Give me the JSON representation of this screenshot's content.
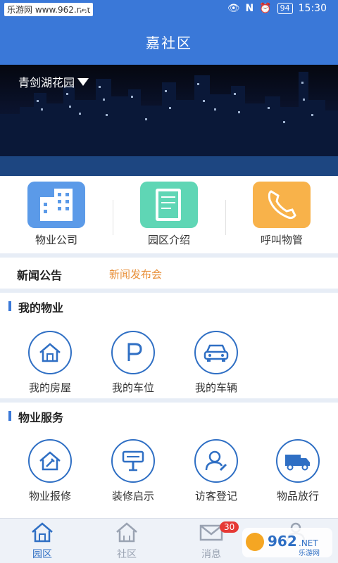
{
  "status_bar": {
    "watermark": "乐游网 www.962.net",
    "battery": "94",
    "time": "15:30"
  },
  "header": {
    "title": "嘉社区"
  },
  "banner": {
    "community": "青剑湖花园"
  },
  "quick_links": [
    {
      "label": "物业公司",
      "icon": "building-icon",
      "color": "#5b9ae8"
    },
    {
      "label": "园区介绍",
      "icon": "document-icon",
      "color": "#5fd6b5"
    },
    {
      "label": "呼叫物管",
      "icon": "phone-icon",
      "color": "#f8b24a"
    }
  ],
  "news": {
    "title": "新闻公告",
    "link": "新闻发布会"
  },
  "my_property": {
    "title": "我的物业",
    "items": [
      {
        "label": "我的房屋",
        "icon": "house-icon"
      },
      {
        "label": "我的车位",
        "icon": "parking-icon"
      },
      {
        "label": "我的车辆",
        "icon": "car-icon"
      }
    ]
  },
  "property_services": {
    "title": "物业服务",
    "items": [
      {
        "label": "物业报修",
        "icon": "repair-house-icon"
      },
      {
        "label": "装修启示",
        "icon": "signboard-icon"
      },
      {
        "label": "访客登记",
        "icon": "visitor-icon"
      },
      {
        "label": "物品放行",
        "icon": "truck-icon"
      }
    ]
  },
  "tabs": [
    {
      "label": "园区",
      "icon": "home-icon",
      "active": true
    },
    {
      "label": "社区",
      "icon": "community-icon",
      "active": false
    },
    {
      "label": "消息",
      "icon": "mail-icon",
      "badge": "30",
      "active": false
    },
    {
      "label": "",
      "icon": "user-icon",
      "active": false
    }
  ],
  "colors": {
    "primary": "#3a78d8",
    "accent_orange": "#e8903a",
    "badge_red": "#e53935"
  },
  "watermark_logo": {
    "text": "962",
    "subtext": "乐游网"
  }
}
